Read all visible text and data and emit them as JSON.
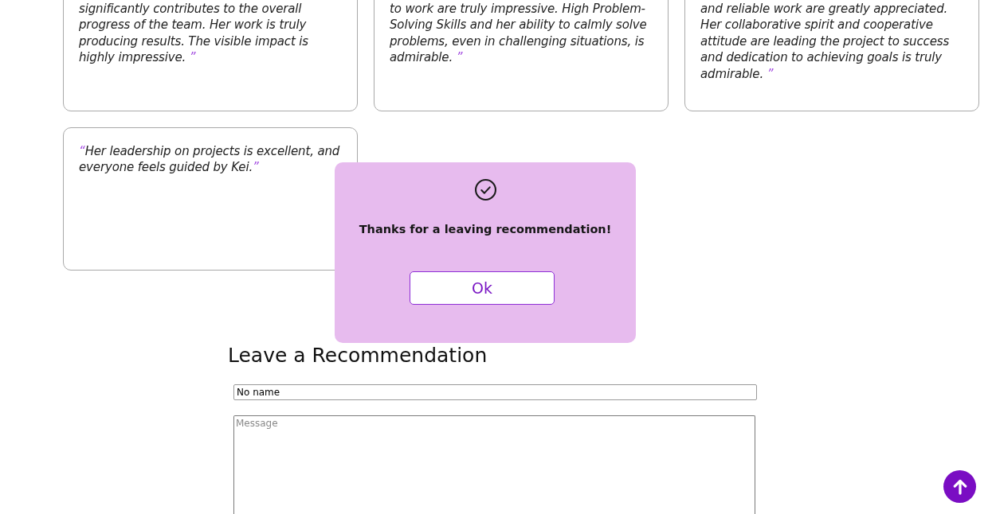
{
  "recommendations": [
    {
      "text": "significantly contributes to the overall progress of the team. Her work is truly producing results. The visible impact is highly impressive. ",
      "close_quote": "”"
    },
    {
      "text": "to work are truly impressive. High Problem-Solving Skills and her ability to calmly solve problems, even in challenging situations, is admirable. ",
      "close_quote": "”"
    },
    {
      "text": "and reliable work are greatly appreciated. Her collaborative spirit and cooperative attitude are leading the project to success and dedication to achieving goals is truly admirable. ",
      "close_quote": "”"
    },
    {
      "open_quote": "“",
      "text": "Her leadership on projects is excellent, and everyone feels guided by Kei.",
      "close_quote": "”"
    }
  ],
  "form": {
    "heading": "Leave a Recommendation",
    "name_field": {
      "value": "No name"
    },
    "message_field": {
      "placeholder": "Message"
    }
  },
  "dialog": {
    "message": "Thanks for a leaving recommendation!",
    "button": "Ok"
  }
}
